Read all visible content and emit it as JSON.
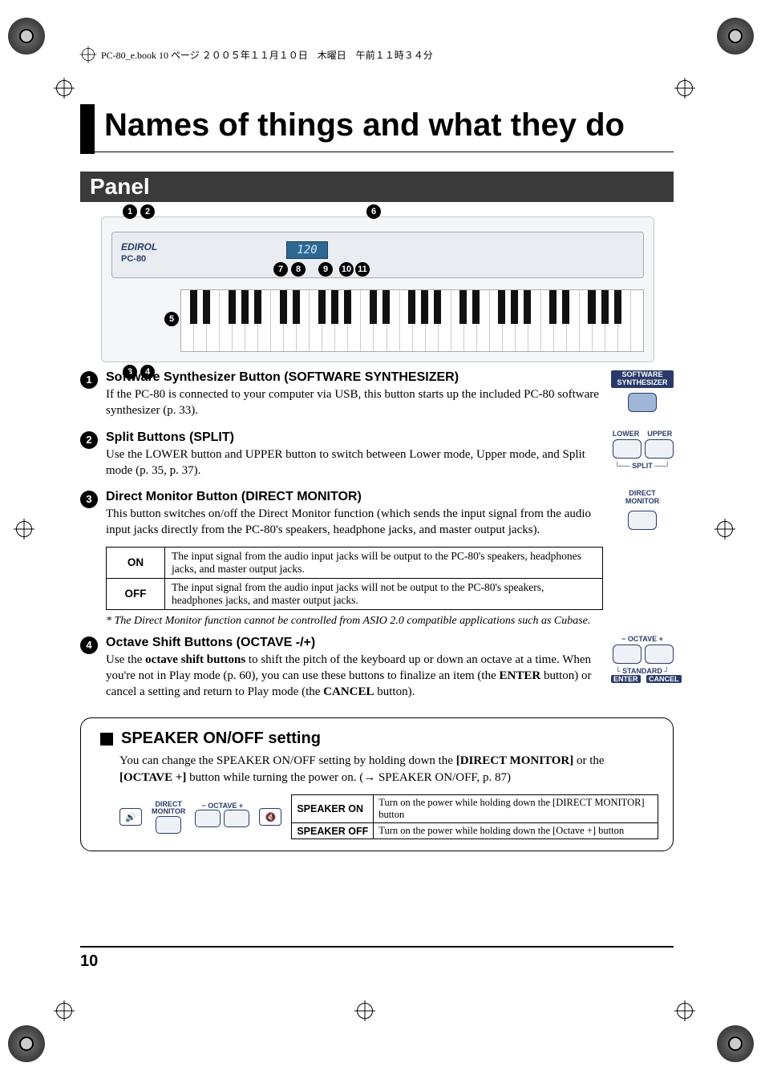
{
  "header": {
    "text": "PC-80_e.book 10 ページ ２００５年１１月１０日　木曜日　午前１１時３４分"
  },
  "title": "Names of things and what they do",
  "panel_heading": "Panel",
  "figure": {
    "brand": "EDIROL",
    "model": "PC-80",
    "lcd": "120",
    "callouts": [
      "1",
      "2",
      "3",
      "4",
      "5",
      "6",
      "7",
      "8",
      "9",
      "10",
      "11"
    ]
  },
  "items": [
    {
      "num": "1",
      "title": "Software Synthesizer Button (SOFTWARE SYNTHESIZER)",
      "text": "If the PC-80 is connected to your computer via USB, this button starts up the included PC-80 software synthesizer (p. 33).",
      "icon": {
        "label_top": "SOFTWARE",
        "label_bot": "SYNTHESIZER"
      }
    },
    {
      "num": "2",
      "title": "Split Buttons (SPLIT)",
      "text": "Use the LOWER button and UPPER button to switch between Lower mode, Upper mode, and Split mode (p. 35, p. 37).",
      "icon": {
        "left": "LOWER",
        "right": "UPPER",
        "bottom": "SPLIT"
      }
    },
    {
      "num": "3",
      "title": "Direct Monitor Button (DIRECT MONITOR)",
      "text": "This button switches on/off the Direct Monitor function (which sends the input signal from the audio input jacks directly from the PC-80's speakers, headphone jacks, and master output jacks).",
      "icon": {
        "label_top": "DIRECT",
        "label_bot": "MONITOR"
      }
    },
    {
      "num": "4",
      "title": "Octave Shift Buttons (OCTAVE -/+)",
      "text_parts": {
        "a": "Use the ",
        "b": "octave shift buttons",
        "c": " to shift the pitch of the keyboard up or down an octave at a time. When you're not in Play mode (p. 60), you can use these buttons to finalize an item (the ",
        "d": "ENTER",
        "e": " button) or cancel a setting and return to Play mode (the ",
        "f": "CANCEL",
        "g": " button)."
      },
      "icon": {
        "top": "− OCTAVE +",
        "mid": "STANDARD",
        "bl": "ENTER",
        "br": "CANCEL"
      }
    }
  ],
  "monitor_table": {
    "rows": [
      {
        "h": "ON",
        "t": "The input signal from the audio input jacks will be output to the PC-80's speakers, headphones jacks, and master output jacks."
      },
      {
        "h": "OFF",
        "t": "The input signal from the audio input jacks will not be output to the PC-80's speakers, headphones jacks, and master output jacks."
      }
    ],
    "note": "*  The Direct Monitor function cannot be controlled from ASIO 2.0 compatible applications such as Cubase."
  },
  "speaker": {
    "title": "SPEAKER ON/OFF setting",
    "text_parts": {
      "a": "You can change the SPEAKER ON/OFF setting by holding down the ",
      "b": "[DIRECT MONITOR]",
      "c": " or the ",
      "d": "[OCTAVE +]",
      "e": " button while turning the power on. (→ SPEAKER ON/OFF, p. 87)"
    },
    "labels": {
      "dm_top": "DIRECT",
      "dm_bot": "MONITOR",
      "oct": "− OCTAVE +"
    },
    "table": {
      "rows": [
        {
          "h": "SPEAKER ON",
          "t": "Turn on the power while holding down the [DIRECT MONITOR] button"
        },
        {
          "h": "SPEAKER OFF",
          "t": "Turn on the power while holding down the [Octave +] button"
        }
      ]
    }
  },
  "page_number": "10"
}
